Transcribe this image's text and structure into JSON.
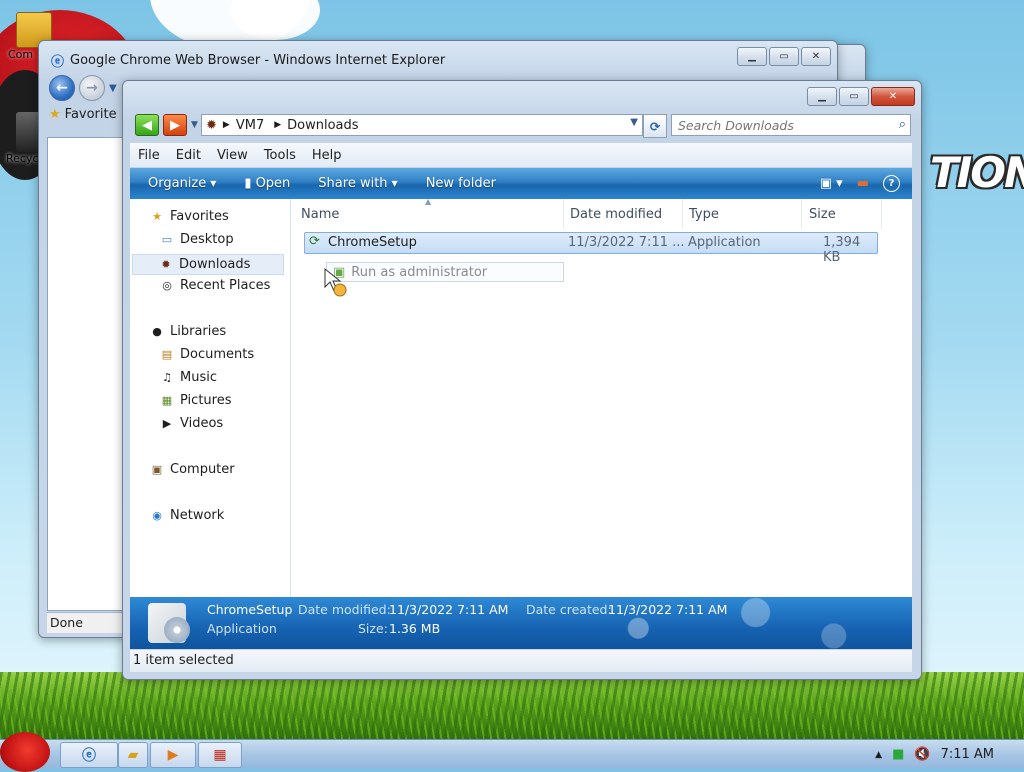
{
  "desktop": {
    "logo_text": "TION",
    "icons": [
      {
        "label": "Com",
        "icon": "computer-icon"
      },
      {
        "label": "Recyc",
        "icon": "recycle-bin-icon"
      }
    ]
  },
  "ie_window": {
    "title": "Google Chrome Web Browser - Windows Internet Explorer",
    "favorites_label": "Favorite",
    "status": "Done"
  },
  "explorer": {
    "breadcrumb": [
      "VM7",
      "Downloads"
    ],
    "search_placeholder": "Search Downloads",
    "menu": [
      "File",
      "Edit",
      "View",
      "Tools",
      "Help"
    ],
    "commands": [
      "Organize",
      "Open",
      "Share with",
      "New folder"
    ],
    "nav": {
      "favorites": {
        "label": "Favorites",
        "items": [
          "Desktop",
          "Downloads",
          "Recent Places"
        ]
      },
      "libraries": {
        "label": "Libraries",
        "items": [
          "Documents",
          "Music",
          "Pictures",
          "Videos"
        ]
      },
      "computer": "Computer",
      "network": "Network"
    },
    "columns": [
      "Name",
      "Date modified",
      "Type",
      "Size"
    ],
    "files": [
      {
        "name": "ChromeSetup",
        "date": "11/3/2022 7:11 ...",
        "type": "Application",
        "size": "1,394 KB"
      }
    ],
    "context_hint": "Run as administrator",
    "details": {
      "name": "ChromeSetup",
      "type": "Application",
      "date_modified_label": "Date modified:",
      "date_modified": "11/3/2022 7:11 AM",
      "date_created_label": "Date created:",
      "date_created": "11/3/2022 7:11 AM",
      "size_label": "Size:",
      "size": "1.36 MB"
    },
    "status": "1 item selected"
  },
  "taskbar": {
    "clock": "7:11 AM"
  },
  "colors": {
    "selection": "#c4dcf6",
    "command_bar": "#1a66ad",
    "close_button": "#c23a20"
  }
}
